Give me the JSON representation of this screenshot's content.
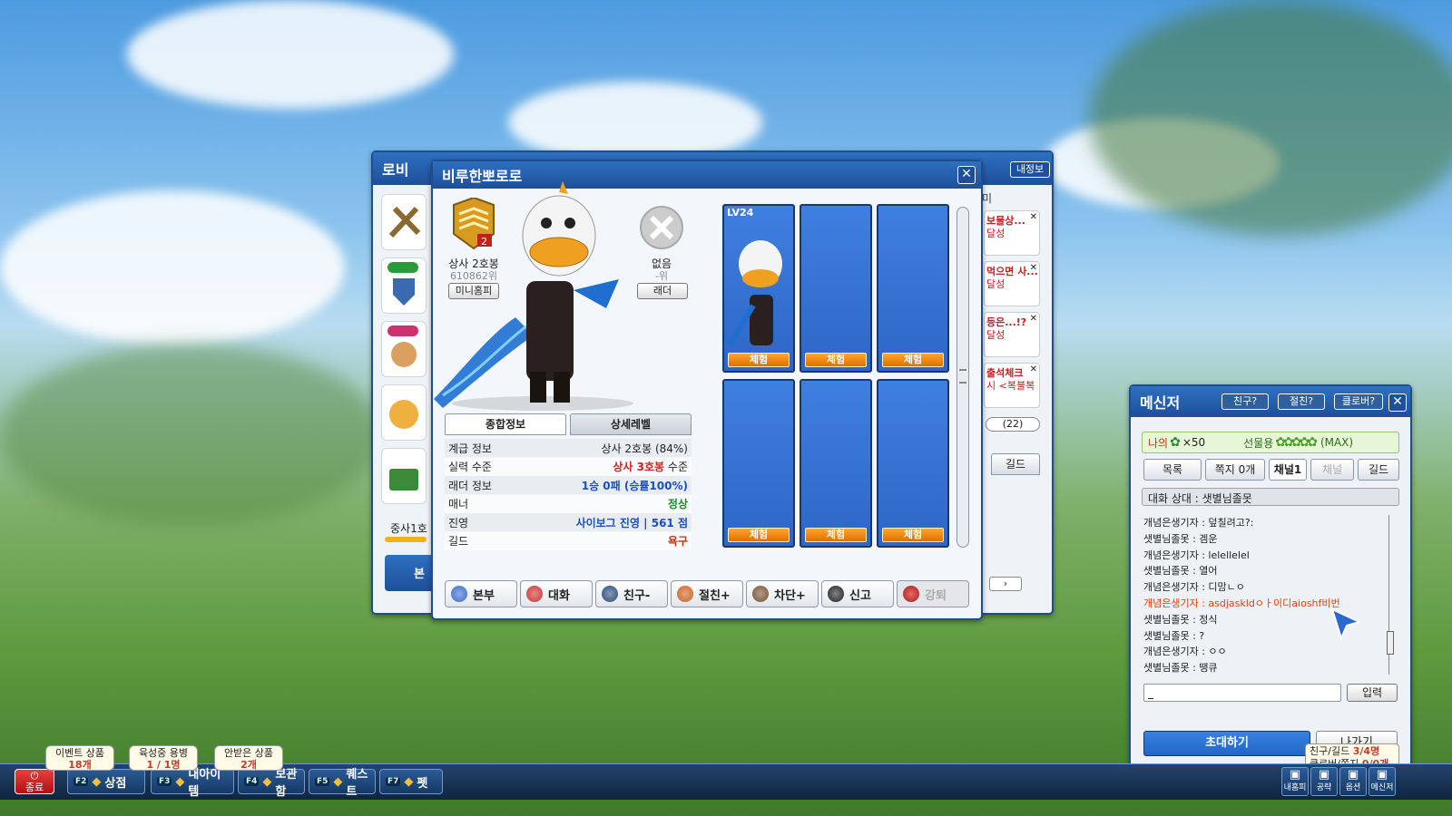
{
  "lobby_window": {
    "title": "로비",
    "player_rank_text": "중사1호",
    "my_info_button": "내정보",
    "friend_tab": "친구",
    "guild_tab": "길드",
    "notice_count": "(22)",
    "bottom_tab": "본"
  },
  "notices": [
    {
      "text": "보물상...",
      "status": "달성"
    },
    {
      "text": "먹으면 사...",
      "status": "달성"
    },
    {
      "text": "등은...!?",
      "status": "달성"
    },
    {
      "text": "출석체크",
      "status": "시 <복불복"
    }
  ],
  "profile": {
    "title": "비루한뽀로로",
    "rank_name": "상사 2호봉",
    "rank_position": "610862위",
    "minihomepage_button": "미니홈피",
    "ladder_status": "없음",
    "ladder_rank": "-위",
    "ladder_button": "래더",
    "tabs": [
      "종합정보",
      "상세레벨"
    ],
    "info_rows": [
      {
        "label": "계급 정보",
        "value": "상사 2호봉 (84%)",
        "color": "#222222"
      },
      {
        "label": "실력 수준",
        "value": "상사 3호봉",
        "suffix": " 수준",
        "color": "#d42020"
      },
      {
        "label": "래더 정보",
        "value": "1승 0패 (승률100%)",
        "color": "#1a4fc0"
      },
      {
        "label": "매너",
        "value": "정상",
        "color": "#1a8a2a"
      },
      {
        "label": "진영",
        "value": "사이보그 진영 | 561 점",
        "color": "#1a4fc0"
      },
      {
        "label": "길드",
        "value": "욕구",
        "color": "#c03010"
      }
    ],
    "slots": [
      {
        "level": "LV24",
        "button": "체험",
        "has_char": true
      },
      {
        "level": "",
        "button": "체험",
        "has_char": false
      },
      {
        "level": "",
        "button": "체험",
        "has_char": false
      },
      {
        "level": "",
        "button": "체험",
        "has_char": false
      },
      {
        "level": "",
        "button": "체험",
        "has_char": false
      },
      {
        "level": "",
        "button": "체험",
        "has_char": false
      }
    ],
    "actions": [
      "본부",
      "대화",
      "친구-",
      "절친+",
      "차단+",
      "신고",
      "강퇴"
    ]
  },
  "messenger": {
    "title": "메신저",
    "header_buttons": [
      "친구?",
      "절친?",
      "클로버?"
    ],
    "my_label": "나의",
    "clover_count": "×50",
    "gift_label": "선물용",
    "gift_max": "(MAX)",
    "tabs": [
      "목록",
      "쪽지 0개",
      "채널1",
      "채널",
      "길드"
    ],
    "chat_status": "대화 상대 : 샛별님졸못",
    "messages": [
      {
        "text": "개념은생기자 : 덮칠려고?:",
        "highlight": false
      },
      {
        "text": "샛별님졸못 : 겜운",
        "highlight": false
      },
      {
        "text": "개념은생기자 : lelellelel",
        "highlight": false
      },
      {
        "text": "샛별님졸못 : 열어",
        "highlight": false
      },
      {
        "text": "개념은생기자 : 디맘ㄴㅇ",
        "highlight": false
      },
      {
        "text": "개념은생기자 : asdjaskldㅇㅏ이디aioshf비번",
        "highlight": true
      },
      {
        "text": "샛별님졸못 : 정식",
        "highlight": false
      },
      {
        "text": "샛별님졸못 : ?",
        "highlight": false
      },
      {
        "text": "개념은생기자 : ㅇㅇ",
        "highlight": false
      },
      {
        "text": "샛별님졸못 : 땡큐",
        "highlight": false
      }
    ],
    "input_value": "_",
    "send_button": "입력",
    "invite_button": "초대하기",
    "exit_button": "나가기",
    "status_box": {
      "friend_guild_label": "친구/길드",
      "friend_guild_value": "3/4명",
      "clover_msg_label": "클로버/쪽지",
      "clover_msg_value": "0/0개"
    }
  },
  "taskbar": {
    "quit": "종료",
    "buttons": [
      {
        "fkey": "F2",
        "label": "상점"
      },
      {
        "fkey": "F3",
        "label": "내아이템"
      },
      {
        "fkey": "F4",
        "label": "보관함"
      },
      {
        "fkey": "F5",
        "label": "퀘스트"
      },
      {
        "fkey": "F7",
        "label": "펫"
      }
    ],
    "bubbles": [
      {
        "title": "이벤트 상품",
        "value": "18개"
      },
      {
        "title": "육성중 용병",
        "value": "1 / 1명"
      },
      {
        "title": "안받은 상품",
        "value": "2개"
      }
    ],
    "right_icons": [
      "내홈피",
      "공략",
      "옵션",
      "메신저"
    ]
  },
  "colors": {
    "title_blue": "#1d4f9a",
    "slot_blue": "#3f7fe0",
    "orange": "#f08a10",
    "invite_blue": "#1f66c8"
  }
}
